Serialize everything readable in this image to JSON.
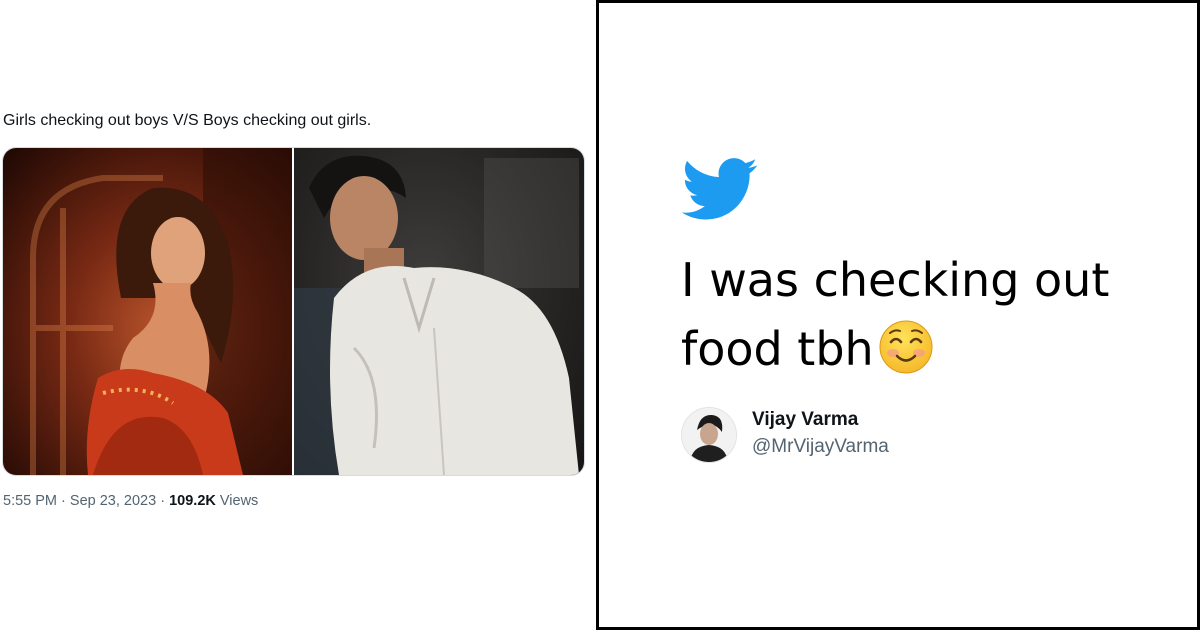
{
  "tweet": {
    "text": "Girls checking out boys V/S Boys checking out girls.",
    "time": "5:55 PM",
    "separator": "·",
    "date": "Sep 23, 2023",
    "views_count": "109.2K",
    "views_label": "Views",
    "media": [
      "woman-in-red-saree-photo",
      "man-in-white-shirt-photo"
    ]
  },
  "quote_card": {
    "icon": "twitter-bird-icon",
    "quote_lines": [
      "I was checking out",
      "food tbh"
    ],
    "emoji": "smiling-face-with-smiling-eyes",
    "author_name": "Vijay Varma",
    "author_handle": "@MrVijayVarma"
  },
  "colors": {
    "twitter_blue": "#1d9bf0",
    "card_border": "#000000",
    "text_primary": "#0f1419",
    "text_secondary": "#536471"
  }
}
